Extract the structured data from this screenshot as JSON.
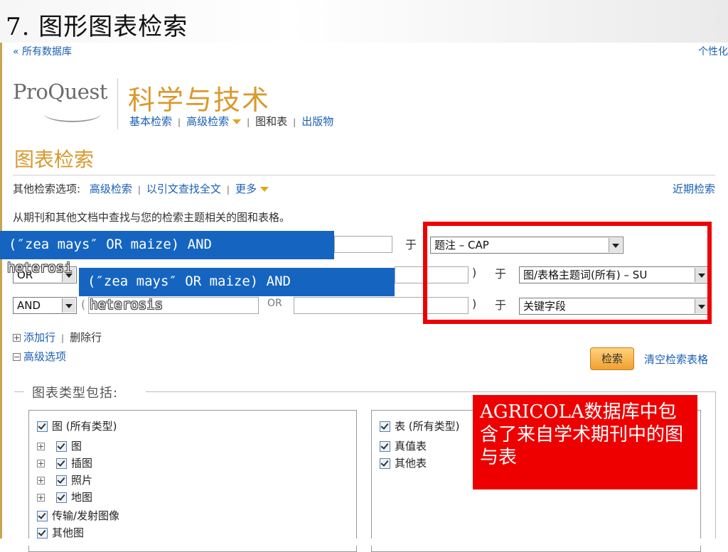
{
  "slide": {
    "title": "7. 图形图表检索"
  },
  "header": {
    "back_link": "« 所有数据库",
    "personalize": "个性化"
  },
  "brand": {
    "logo": "ProQuest",
    "product": "科学与技术"
  },
  "product_nav": {
    "basic": "基本检索",
    "advanced": "高级检索",
    "figures": "图和表",
    "publications": "出版物"
  },
  "page": {
    "heading": "图表检索",
    "other_options_label": "其他检索选项:",
    "other_options": {
      "advanced": "高级检索",
      "citation": "以引文查找全文",
      "more": "更多"
    },
    "recent_search": "近期检索",
    "instruction": "从期刊和其他文档中查找与您的检索主题相关的图和表格。"
  },
  "query": {
    "overlay_text_1": "(″zea mays″ OR maize) AND",
    "overlay_text_2": "(″zea mays″ OR maize) AND",
    "ghost_text_1": "heterosi",
    "ghost_text_2": "heterosis",
    "paren_marks": {
      "open_2": "(",
      "open_3": "(",
      "close_2": ")",
      "close_3": ")"
    },
    "operator_or_between": "OR",
    "in_label": "于",
    "rows": [
      {
        "operator": "",
        "field": "题注 – CAP"
      },
      {
        "operator": "OR",
        "field": "图/表格主题词(所有) – SU"
      },
      {
        "operator": "AND",
        "field": "关键字段"
      }
    ],
    "add_row": "添加行",
    "delete_row": "删除行",
    "advanced_options": "高级选项",
    "search_button": "检索",
    "clear_form": "清空检索表格"
  },
  "chart_types": {
    "legend": "图表类型包括:",
    "figures": {
      "all": "图 (所有类型)",
      "items": [
        "图",
        "插图",
        "照片",
        "地图"
      ],
      "transmission": "传输/发射图像",
      "other": "其他图"
    },
    "tables": {
      "all": "表 (所有类型)",
      "items": [
        "真值表",
        "其他表"
      ]
    }
  },
  "callout": {
    "text": "AGRICOLA数据库中包含了来自学术期刊中的图与表"
  },
  "colors": {
    "accent": "#d9992d",
    "link": "#1a5fb4",
    "highlight_red": "#ee0000",
    "overlay_blue": "#1565c0"
  }
}
